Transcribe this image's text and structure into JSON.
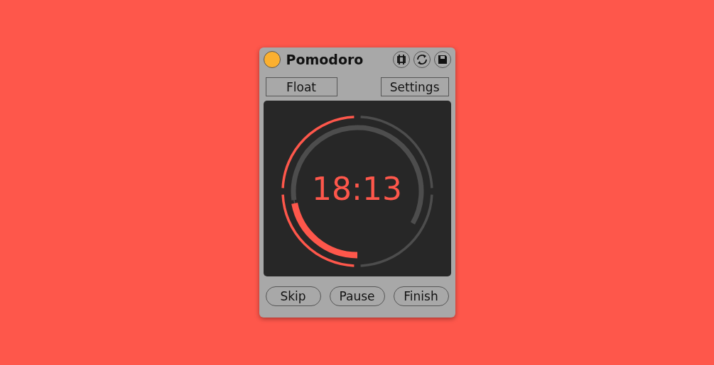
{
  "window": {
    "title": "Pomodoro"
  },
  "toolbar_icons": [
    {
      "kind": "frame"
    },
    {
      "kind": "sync"
    },
    {
      "kind": "save"
    }
  ],
  "mode_buttons": [
    "Float",
    "Settings"
  ],
  "timer": {
    "time": "18:13",
    "sessions": [
      {
        "done": true
      },
      {
        "done": true
      },
      {
        "done": false
      },
      {
        "done": false
      }
    ]
  },
  "buttons": [
    "Skip",
    "Pause",
    "Finish"
  ]
}
